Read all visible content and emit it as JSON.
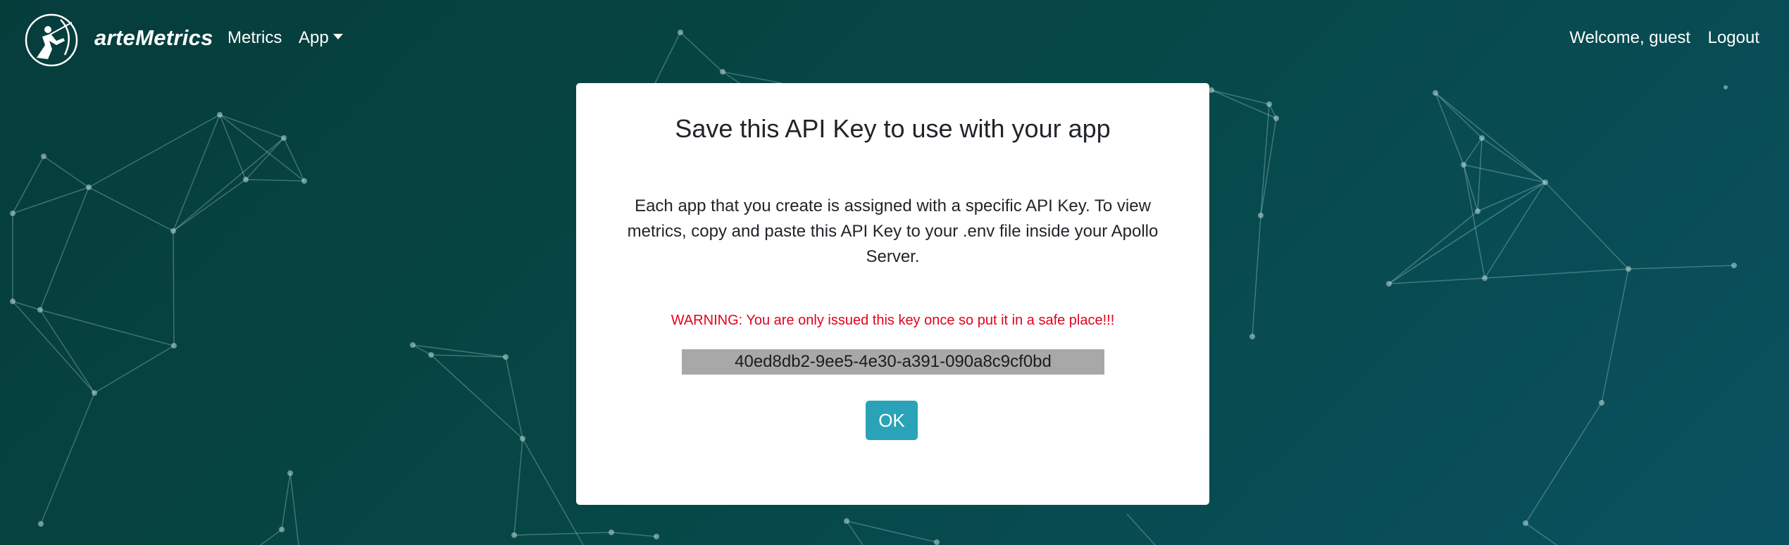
{
  "navbar": {
    "brand": "arteMetrics",
    "links": {
      "metrics": "Metrics",
      "app": "App"
    },
    "welcome": "Welcome, guest",
    "logout": "Logout"
  },
  "modal": {
    "title": "Save this API Key to use with your app",
    "description": "Each app that you create is assigned with a specific API Key. To view metrics, copy and paste this API Key to your .env file inside your Apollo Server.",
    "warning": "WARNING: You are only issued this key once so put it in a safe place!!!",
    "api_key": "40ed8db2-9ee5-4e30-a391-090a8c9cf0bd",
    "ok_label": "OK"
  },
  "icons": {
    "logo": "archer-logo-icon",
    "dropdown": "caret-down-icon"
  },
  "colors": {
    "background": "#064745",
    "accent_button": "#2aa3b8",
    "warning": "#e3001b",
    "key_box": "#a8a8a8"
  }
}
